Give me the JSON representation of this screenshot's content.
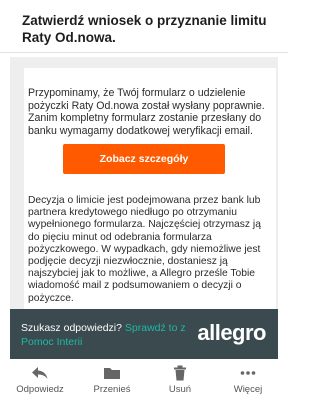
{
  "email": {
    "subject": "Zatwierdź wniosek o przyznanie limitu Raty Od.nowa."
  },
  "message": {
    "paragraph1": "Przypominamy, że Twój formularz o udzielenie pożyczki Raty Od.nowa został wysłany poprawnie. Zanim kompletny formularz zostanie przesłany do banku wymagamy dodatkowej weryfikacji email.",
    "cta_label": "Zobacz szczegóły",
    "cta_color": "#ff5a00",
    "paragraph2": "Decyzja o limicie jest podejmowana przez bank lub partnera kredytowego niedługo po otrzymaniu wypełnionego formularza. Najczęściej otrzymasz ją do pięciu minut od odebrania formularza pożyczkowego. W wypadkach, gdy niemożliwe jest podjęcie decyzji niezwłocznie, dostaniesz ją najszybciej jak to możliwe, a Allegro prześle Tobie wiadomość mail z podsumowaniem o decyzji o pożyczce."
  },
  "help_banner": {
    "question": "Szukasz odpowiedzi?",
    "link_text": "Sprawdź to z Pomoc Interii",
    "logo_text": "allegro",
    "background": "#3a4a4f",
    "link_color": "#1fb8a6"
  },
  "toolbar": {
    "items": [
      {
        "label": "Odpowiedz",
        "icon": "reply-icon"
      },
      {
        "label": "Przenieś",
        "icon": "folder-icon"
      },
      {
        "label": "Usuń",
        "icon": "trash-icon"
      },
      {
        "label": "Więcej",
        "icon": "more-dots-icon"
      }
    ]
  }
}
